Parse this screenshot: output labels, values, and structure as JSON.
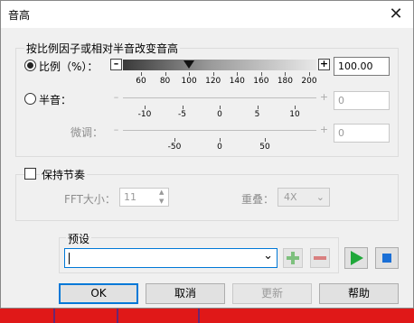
{
  "window": {
    "title": "音高",
    "close_label": "✕"
  },
  "pitch_group": {
    "title": "按比例因子或相对半音改变音高",
    "ratio": {
      "label": "比例（%）：",
      "value": "100.00",
      "ticks": [
        "60",
        "80",
        "100",
        "120",
        "140",
        "160",
        "180",
        "200"
      ],
      "minus": "–",
      "plus": "+"
    },
    "semitone": {
      "label": "半音：",
      "value": "0",
      "ticks": [
        "-10",
        "-5",
        "0",
        "5",
        "10"
      ],
      "minus": "–",
      "plus": "+"
    },
    "fine": {
      "label": "微调：",
      "value": "0",
      "ticks": [
        "-50",
        "0",
        "50"
      ],
      "minus": "–",
      "plus": "+"
    }
  },
  "tempo_group": {
    "checkbox_label": "保持节奏",
    "fft_label": "FFT大小：",
    "fft_value": "11",
    "overlap_label": "重叠：",
    "overlap_value": "4X"
  },
  "preset": {
    "label": "预设",
    "value": ""
  },
  "buttons": {
    "ok": "OK",
    "cancel": "取消",
    "update": "更新",
    "help": "帮助"
  },
  "colors": {
    "accent": "#0078d7",
    "play": "#1fa83a",
    "stop": "#1a6fd6",
    "add": "#7ec07e",
    "remove": "#d98080",
    "wave_bg": "#c8c8c8",
    "wave_red": "#e01818",
    "wave_blue": "#1a2fb0"
  }
}
